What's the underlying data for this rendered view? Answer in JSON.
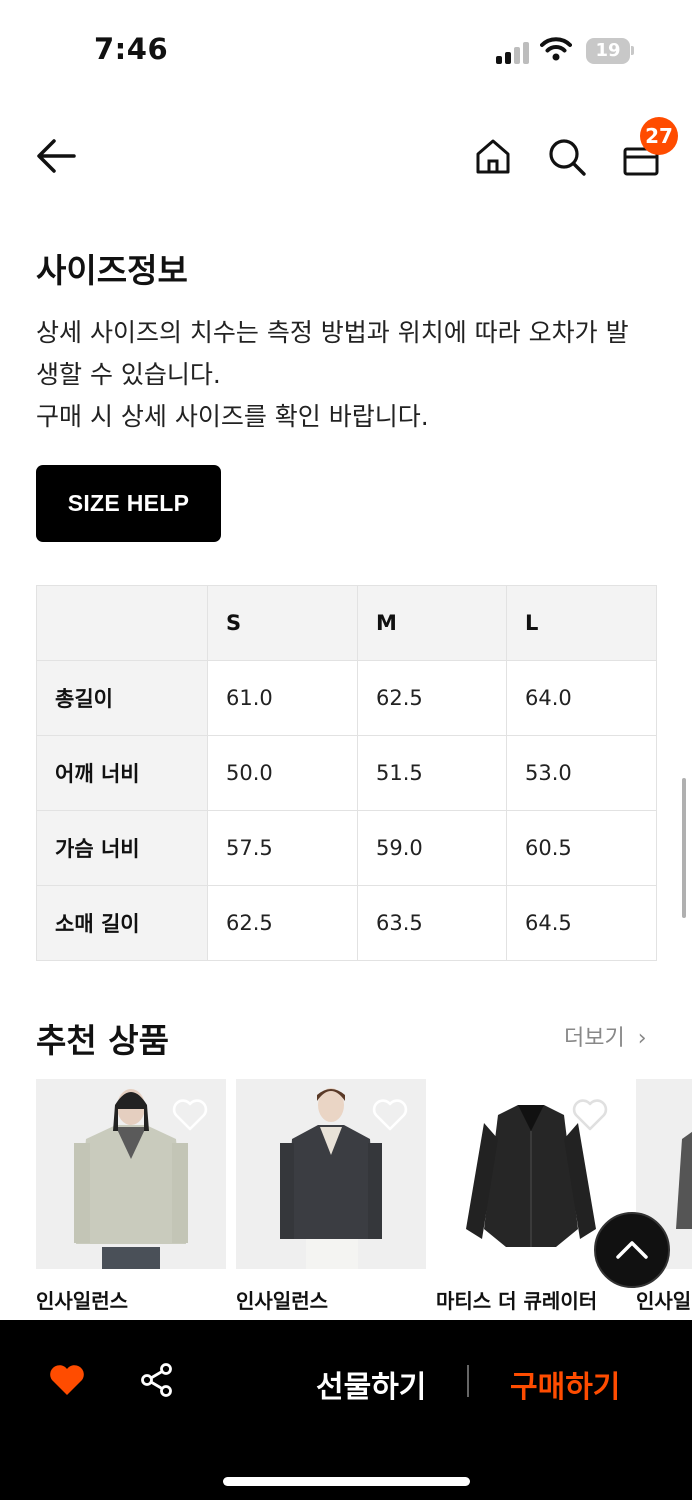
{
  "status_bar": {
    "time": "7:46",
    "battery": "19"
  },
  "header": {
    "cart_count": "27"
  },
  "size_info": {
    "title": "사이즈정보",
    "description_lines": [
      "상세 사이즈의 치수는 측정 방법과 위치에 따라 오차가 발",
      "생할 수 있습니다.",
      "구매 시 상세 사이즈를 확인 바랍니다."
    ],
    "size_help_label": "SIZE HELP",
    "table": {
      "columns": [
        "",
        "S",
        "M",
        "L"
      ],
      "rows": [
        {
          "label": "총길이",
          "values": [
            "61.0",
            "62.5",
            "64.0"
          ]
        },
        {
          "label": "어깨 너비",
          "values": [
            "50.0",
            "51.5",
            "53.0"
          ]
        },
        {
          "label": "가슴 너비",
          "values": [
            "57.5",
            "59.0",
            "60.5"
          ]
        },
        {
          "label": "소매 길이",
          "values": [
            "62.5",
            "63.5",
            "64.5"
          ]
        }
      ]
    }
  },
  "recommended": {
    "title": "추천 상품",
    "more_label": "더보기",
    "items": [
      {
        "brand": "인사일런스"
      },
      {
        "brand": "인사일런스"
      },
      {
        "brand": "마티스 더 큐레이터"
      },
      {
        "brand": "인사일"
      }
    ]
  },
  "bottom_bar": {
    "gift_label": "선물하기",
    "buy_label": "구매하기"
  },
  "colors": {
    "accent": "#ff4c00",
    "bar_bg": "#000000"
  }
}
